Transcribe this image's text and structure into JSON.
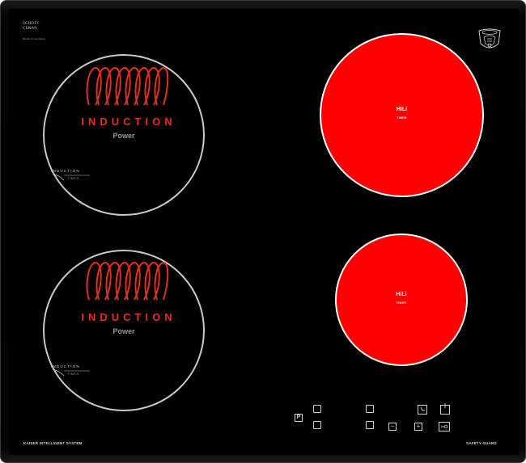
{
  "brand": {
    "logo_line1": "SCHOTT",
    "logo_line2": "CERAN",
    "made_in": "Made in Germany",
    "emblem_icon": "kaiser-crest-icon"
  },
  "zones": {
    "left_top": {
      "label": "INDUCTION",
      "power": "Power",
      "timer_line1": "INDUCTION",
      "timer_line2": "TIMER"
    },
    "left_bottom": {
      "label": "INDUCTION",
      "power": "Power",
      "timer_line1": "INDUCTION",
      "timer_line2": "TIMER"
    },
    "right_top": {
      "title": "HiLi",
      "subtitle": "TIMER"
    },
    "right_bottom": {
      "title": "HiLi",
      "subtitle": "TIMER"
    }
  },
  "controls": {
    "pause_label": "P",
    "minus_label": "−",
    "plus_label": "+",
    "timer_icon": "clock-icon",
    "power_icon": "power-icon",
    "lock_icon": "key-lock-icon"
  },
  "footer": {
    "left": "KAISER INTELLIGENT SYSTEM",
    "right": "SAFETY GUARD"
  },
  "colors": {
    "glass": "#000000",
    "induction_text": "#e0301e",
    "hili_zone": "#ff0000",
    "ring": "#c9c9c9"
  }
}
